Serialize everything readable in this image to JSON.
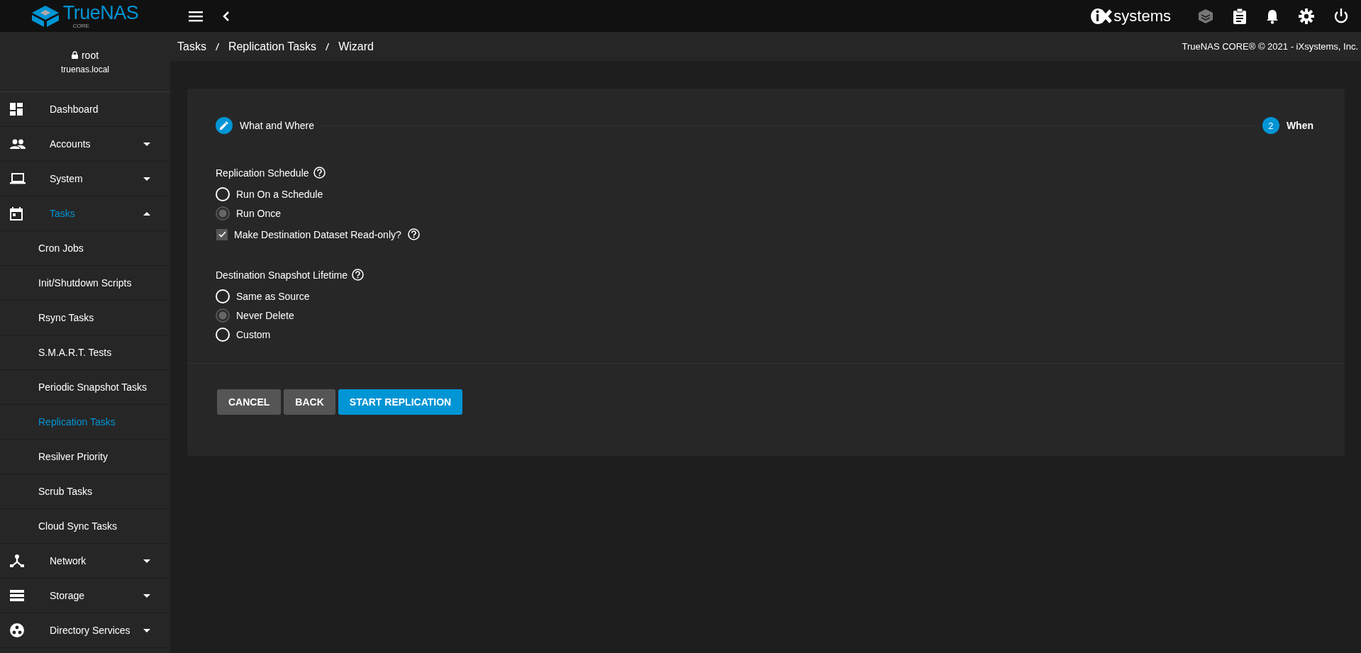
{
  "topbar": {
    "logo": {
      "name": "TrueNAS",
      "edition": "CORE"
    },
    "vendor": "systems"
  },
  "user": {
    "name": "root",
    "host": "truenas.local"
  },
  "breadcrumb": [
    "Tasks",
    "Replication Tasks",
    "Wizard"
  ],
  "copyright": "TrueNAS CORE® © 2021 - iXsystems, Inc.",
  "sidebar": {
    "items": [
      {
        "label": "Dashboard",
        "selected": false
      },
      {
        "label": "Accounts",
        "selected": false,
        "expanded": false
      },
      {
        "label": "System",
        "selected": false,
        "expanded": false
      },
      {
        "label": "Tasks",
        "selected": true,
        "expanded": true,
        "children": [
          {
            "label": "Cron Jobs",
            "selected": false
          },
          {
            "label": "Init/Shutdown Scripts",
            "selected": false
          },
          {
            "label": "Rsync Tasks",
            "selected": false
          },
          {
            "label": "S.M.A.R.T. Tests",
            "selected": false
          },
          {
            "label": "Periodic Snapshot Tasks",
            "selected": false
          },
          {
            "label": "Replication Tasks",
            "selected": true
          },
          {
            "label": "Resilver Priority",
            "selected": false
          },
          {
            "label": "Scrub Tasks",
            "selected": false
          },
          {
            "label": "Cloud Sync Tasks",
            "selected": false
          }
        ]
      },
      {
        "label": "Network",
        "selected": false,
        "expanded": false
      },
      {
        "label": "Storage",
        "selected": false,
        "expanded": false
      },
      {
        "label": "Directory Services",
        "selected": false,
        "expanded": false
      }
    ]
  },
  "stepper": [
    {
      "label": "What and Where",
      "kind": "done"
    },
    {
      "label": "When",
      "kind": "current",
      "marker": "2"
    }
  ],
  "sections": [
    {
      "title": "Replication Schedule",
      "options": [
        {
          "label": "Run On a Schedule",
          "selected": false
        },
        {
          "label": "Run Once",
          "selected": true
        }
      ],
      "checkbox": {
        "label": "Make Destination Dataset Read-only?",
        "checked": true
      }
    },
    {
      "title": "Destination Snapshot Lifetime",
      "options": [
        {
          "label": "Same as Source",
          "selected": false
        },
        {
          "label": "Never Delete",
          "selected": true
        },
        {
          "label": "Custom",
          "selected": false
        }
      ]
    }
  ],
  "buttons": [
    {
      "label": "CANCEL",
      "kind": "secondary"
    },
    {
      "label": "BACK",
      "kind": "secondary"
    },
    {
      "label": "START REPLICATION",
      "kind": "primary"
    }
  ]
}
